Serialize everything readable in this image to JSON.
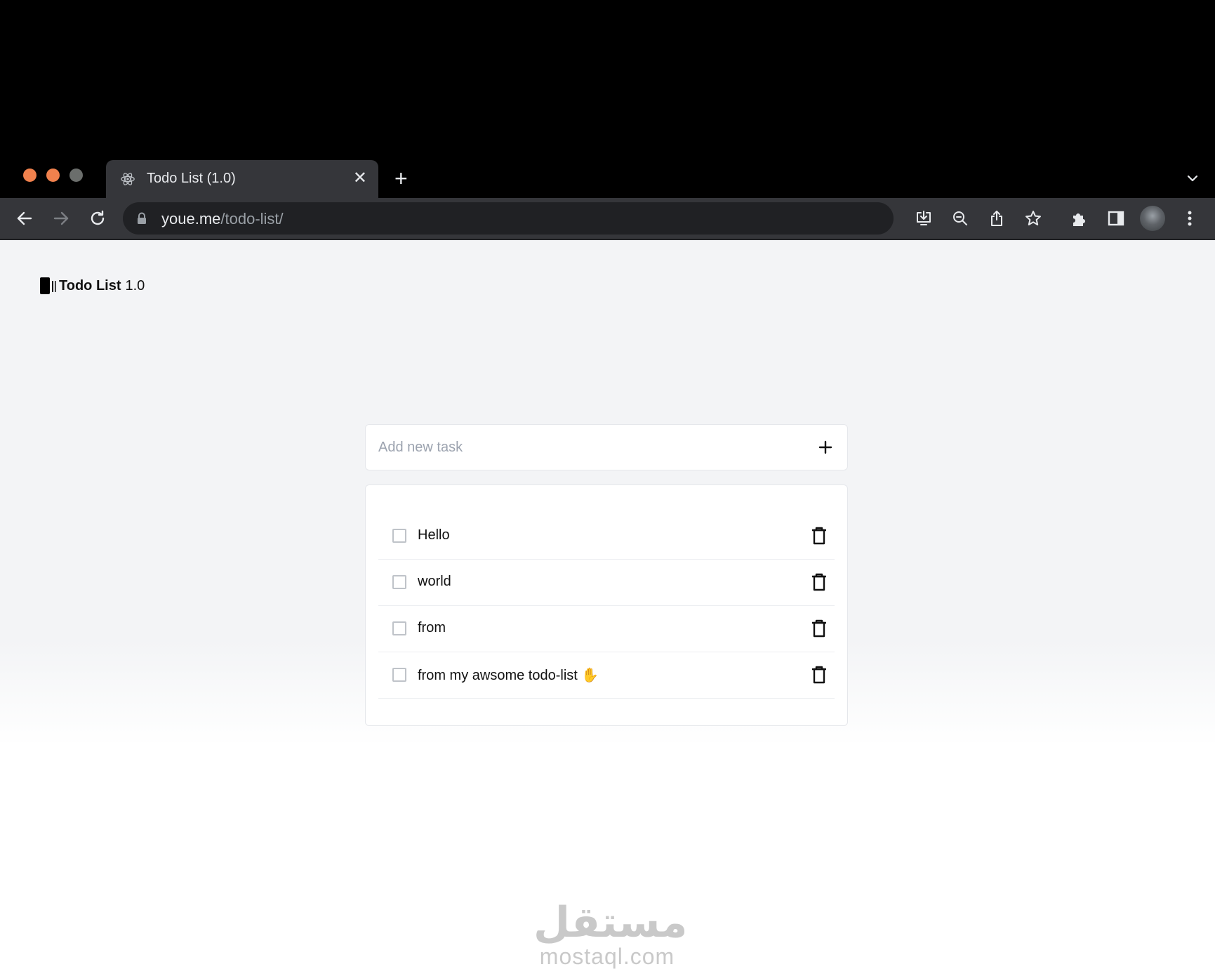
{
  "browser": {
    "tab": {
      "title": "Todo List (1.0)",
      "favicon": "react-atom-icon"
    },
    "url": {
      "domain": "youe.me",
      "path": "/todo-list/"
    }
  },
  "app": {
    "brand": {
      "name": "Todo List",
      "version": "1.0"
    },
    "add_task": {
      "placeholder": "Add new task"
    },
    "tasks": [
      {
        "text": "Hello",
        "done": false
      },
      {
        "text": "world",
        "done": false
      },
      {
        "text": "from",
        "done": false
      },
      {
        "text": "from my awsome todo-list ✋",
        "done": false
      }
    ]
  },
  "watermark": {
    "arabic": "مستقل",
    "latin": "mostaql.com"
  },
  "colors": {
    "traffic_close": "#f0814d",
    "traffic_min": "#f0814d",
    "traffic_max": "#6b6e6c",
    "toolbar": "#35363a",
    "page_bg": "#f3f4f6"
  }
}
